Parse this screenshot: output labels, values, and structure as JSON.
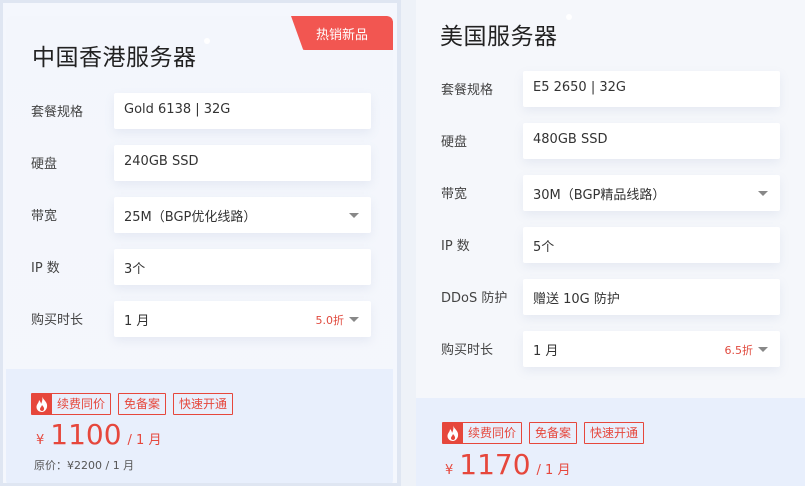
{
  "cards": [
    {
      "title": "中国香港服务器",
      "badge": "热销新品",
      "rows": [
        {
          "label": "套餐规格",
          "value": "Gold 6138 | 32G"
        },
        {
          "label": "硬盘",
          "value": "240GB SSD"
        },
        {
          "label": "带宽",
          "value": "25M（BGP优化线路）",
          "dropdown": true
        },
        {
          "label": "IP 数",
          "value": "3个"
        },
        {
          "label": "购买时长",
          "value": "1 月",
          "discount": "5.0折",
          "dropdown": true
        }
      ],
      "tags": [
        "续费同价",
        "免备案",
        "快速开通"
      ],
      "currency": "¥",
      "price": "1100",
      "unit": "/ 1 月",
      "original_price": "原价：¥2200 / 1 月"
    },
    {
      "title": "美国服务器",
      "rows": [
        {
          "label": "套餐规格",
          "value": "E5 2650 | 32G"
        },
        {
          "label": "硬盘",
          "value": "480GB SSD"
        },
        {
          "label": "带宽",
          "value": "30M（BGP精品线路）",
          "dropdown": true
        },
        {
          "label": "IP 数",
          "value": "5个"
        },
        {
          "label": "DDoS 防护",
          "value": "赠送 10G 防护"
        },
        {
          "label": "购买时长",
          "value": "1 月",
          "discount": "6.5折",
          "dropdown": true
        }
      ],
      "tags": [
        "续费同价",
        "免备案",
        "快速开通"
      ],
      "currency": "¥",
      "price": "1170",
      "unit": "/ 1 月"
    }
  ],
  "icons": {
    "tag_icon": "fire-icon",
    "dropdown_icon": "caret-down-icon"
  },
  "colors": {
    "accent": "#e6473c",
    "badge": "#f25651",
    "price_bg": "#e8effc"
  }
}
